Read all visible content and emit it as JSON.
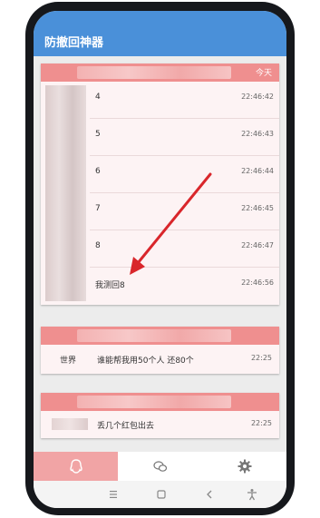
{
  "app": {
    "title": "防撤回神器"
  },
  "card1": {
    "today_label": "今天",
    "messages": [
      {
        "text": "4",
        "time": "22:46:42"
      },
      {
        "text": "5",
        "time": "22:46:43"
      },
      {
        "text": "6",
        "time": "22:46:44"
      },
      {
        "text": "7",
        "time": "22:46:45"
      },
      {
        "text": "8",
        "time": "22:46:47"
      },
      {
        "text": "我测回8",
        "time": "22:46:56"
      }
    ]
  },
  "card2": {
    "sender": "世界",
    "text": "谁能帮我用50个人 还80个",
    "time": "22:25"
  },
  "card3": {
    "text": "丢几个红包出去",
    "time": "22:25"
  },
  "nav": {
    "items": [
      "qq-icon",
      "wechat-icon",
      "settings-icon"
    ],
    "active": 0
  },
  "colors": {
    "appbar": "#4a90d9",
    "card_header": "#ef8f8f",
    "nav_active": "#f1a4a5",
    "annotation_arrow": "#d9262b"
  }
}
